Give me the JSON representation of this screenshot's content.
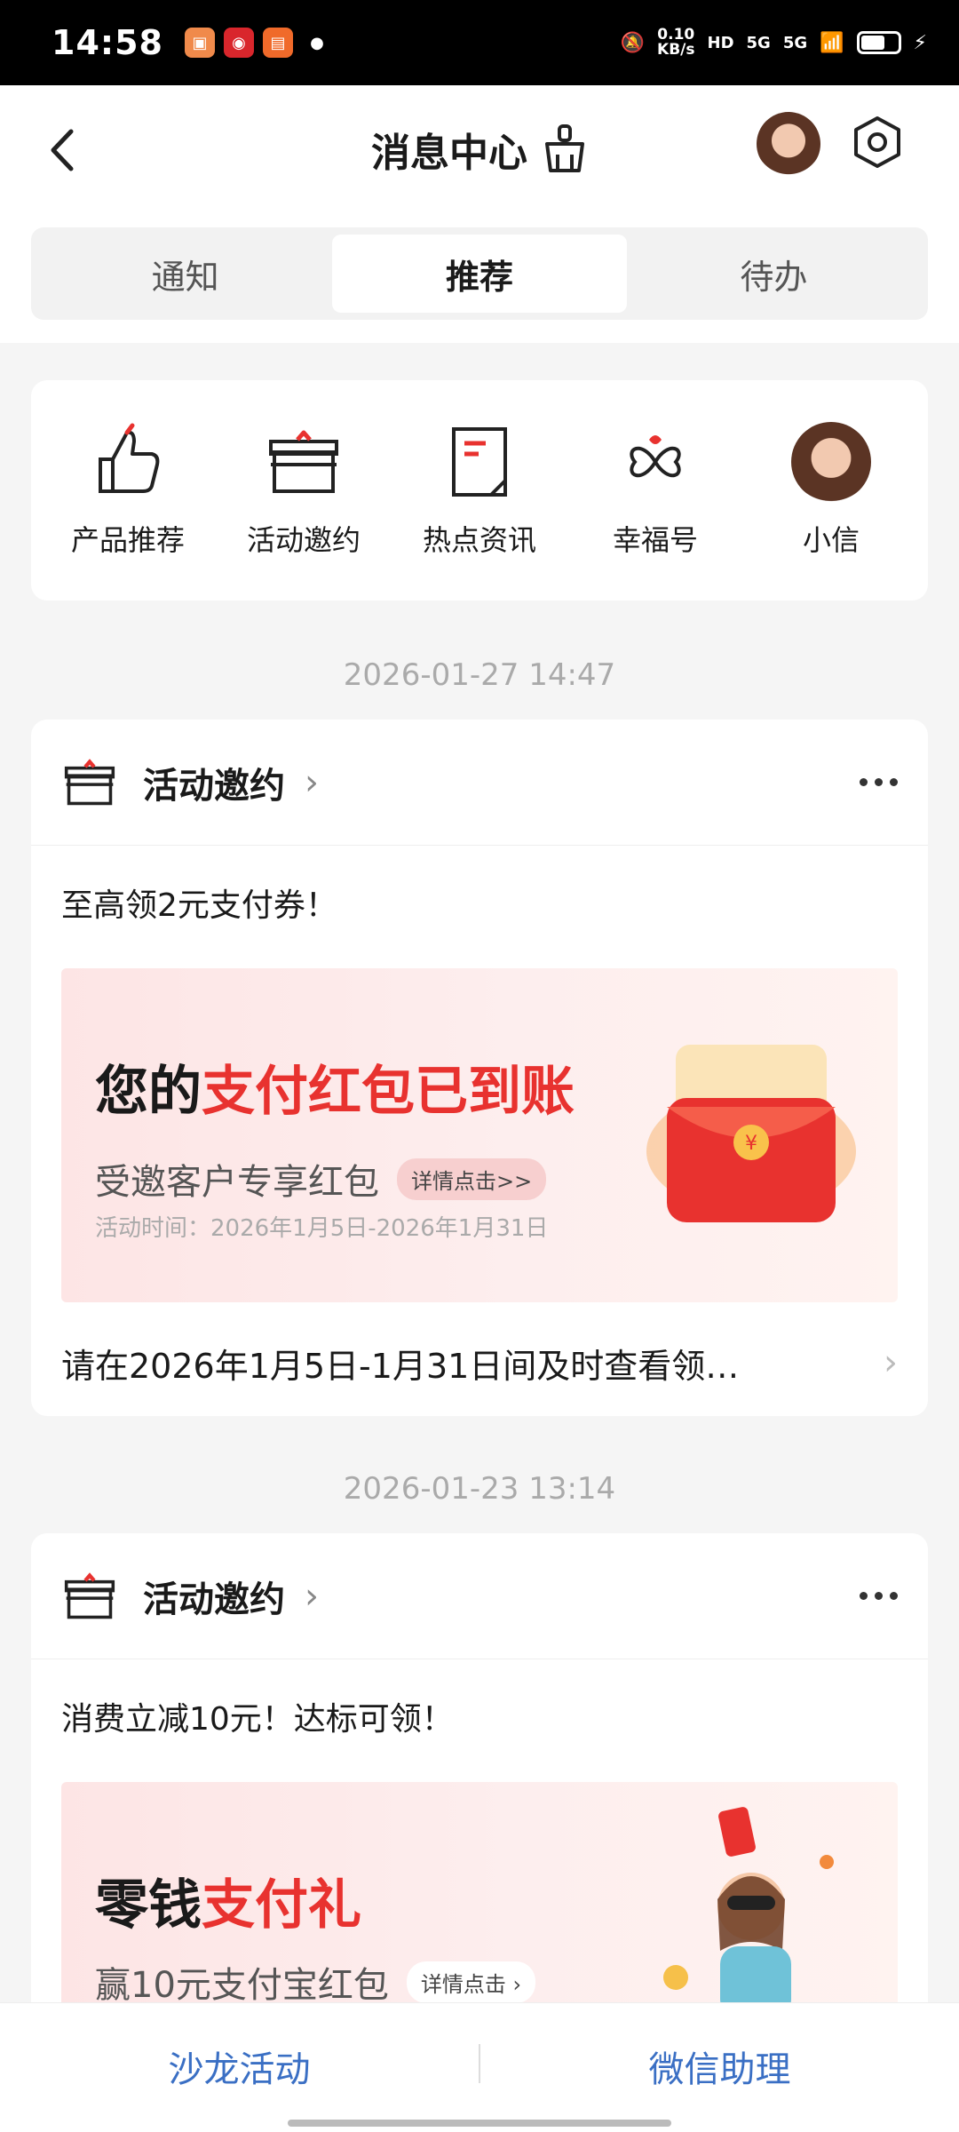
{
  "statusbar": {
    "time": "14:58",
    "net_speed_value": "0.10",
    "net_speed_unit": "KB/s",
    "sig1": "5G",
    "sig2": "5G"
  },
  "header": {
    "title": "消息中心"
  },
  "tabs": [
    {
      "label": "通知"
    },
    {
      "label": "推荐"
    },
    {
      "label": "待办"
    }
  ],
  "categories": [
    {
      "label": "产品推荐",
      "icon": "thumbs-up-icon"
    },
    {
      "label": "活动邀约",
      "icon": "gift-icon"
    },
    {
      "label": "热点资讯",
      "icon": "document-icon"
    },
    {
      "label": "幸福号",
      "icon": "clover-icon"
    },
    {
      "label": "小信",
      "icon": "avatar-icon"
    }
  ],
  "messages": [
    {
      "timestamp": "2026-01-27 14:47",
      "category": "活动邀约",
      "subtitle": "至高领2元支付券！",
      "banner": {
        "headline_black": "您的",
        "headline_red": "支付红包已到账",
        "subline": "受邀客户专享红包",
        "pill": "详情点击>>",
        "period": "活动时间：2026年1月5日-2026年1月31日"
      },
      "footer": "请在2026年1月5日-1月31日间及时查看领…"
    },
    {
      "timestamp": "2026-01-23 13:14",
      "category": "活动邀约",
      "subtitle": "消费立减10元！达标可领！",
      "banner": {
        "headline_black": "零钱",
        "headline_red": "支付礼",
        "subline": "赢10元支付宝红包",
        "pill": "详情点击 ›"
      }
    }
  ],
  "bottom_bar": {
    "left": "沙龙活动",
    "right": "微信助理"
  },
  "colors": {
    "accent_red": "#e8322f",
    "link_blue": "#3a6fc4"
  }
}
